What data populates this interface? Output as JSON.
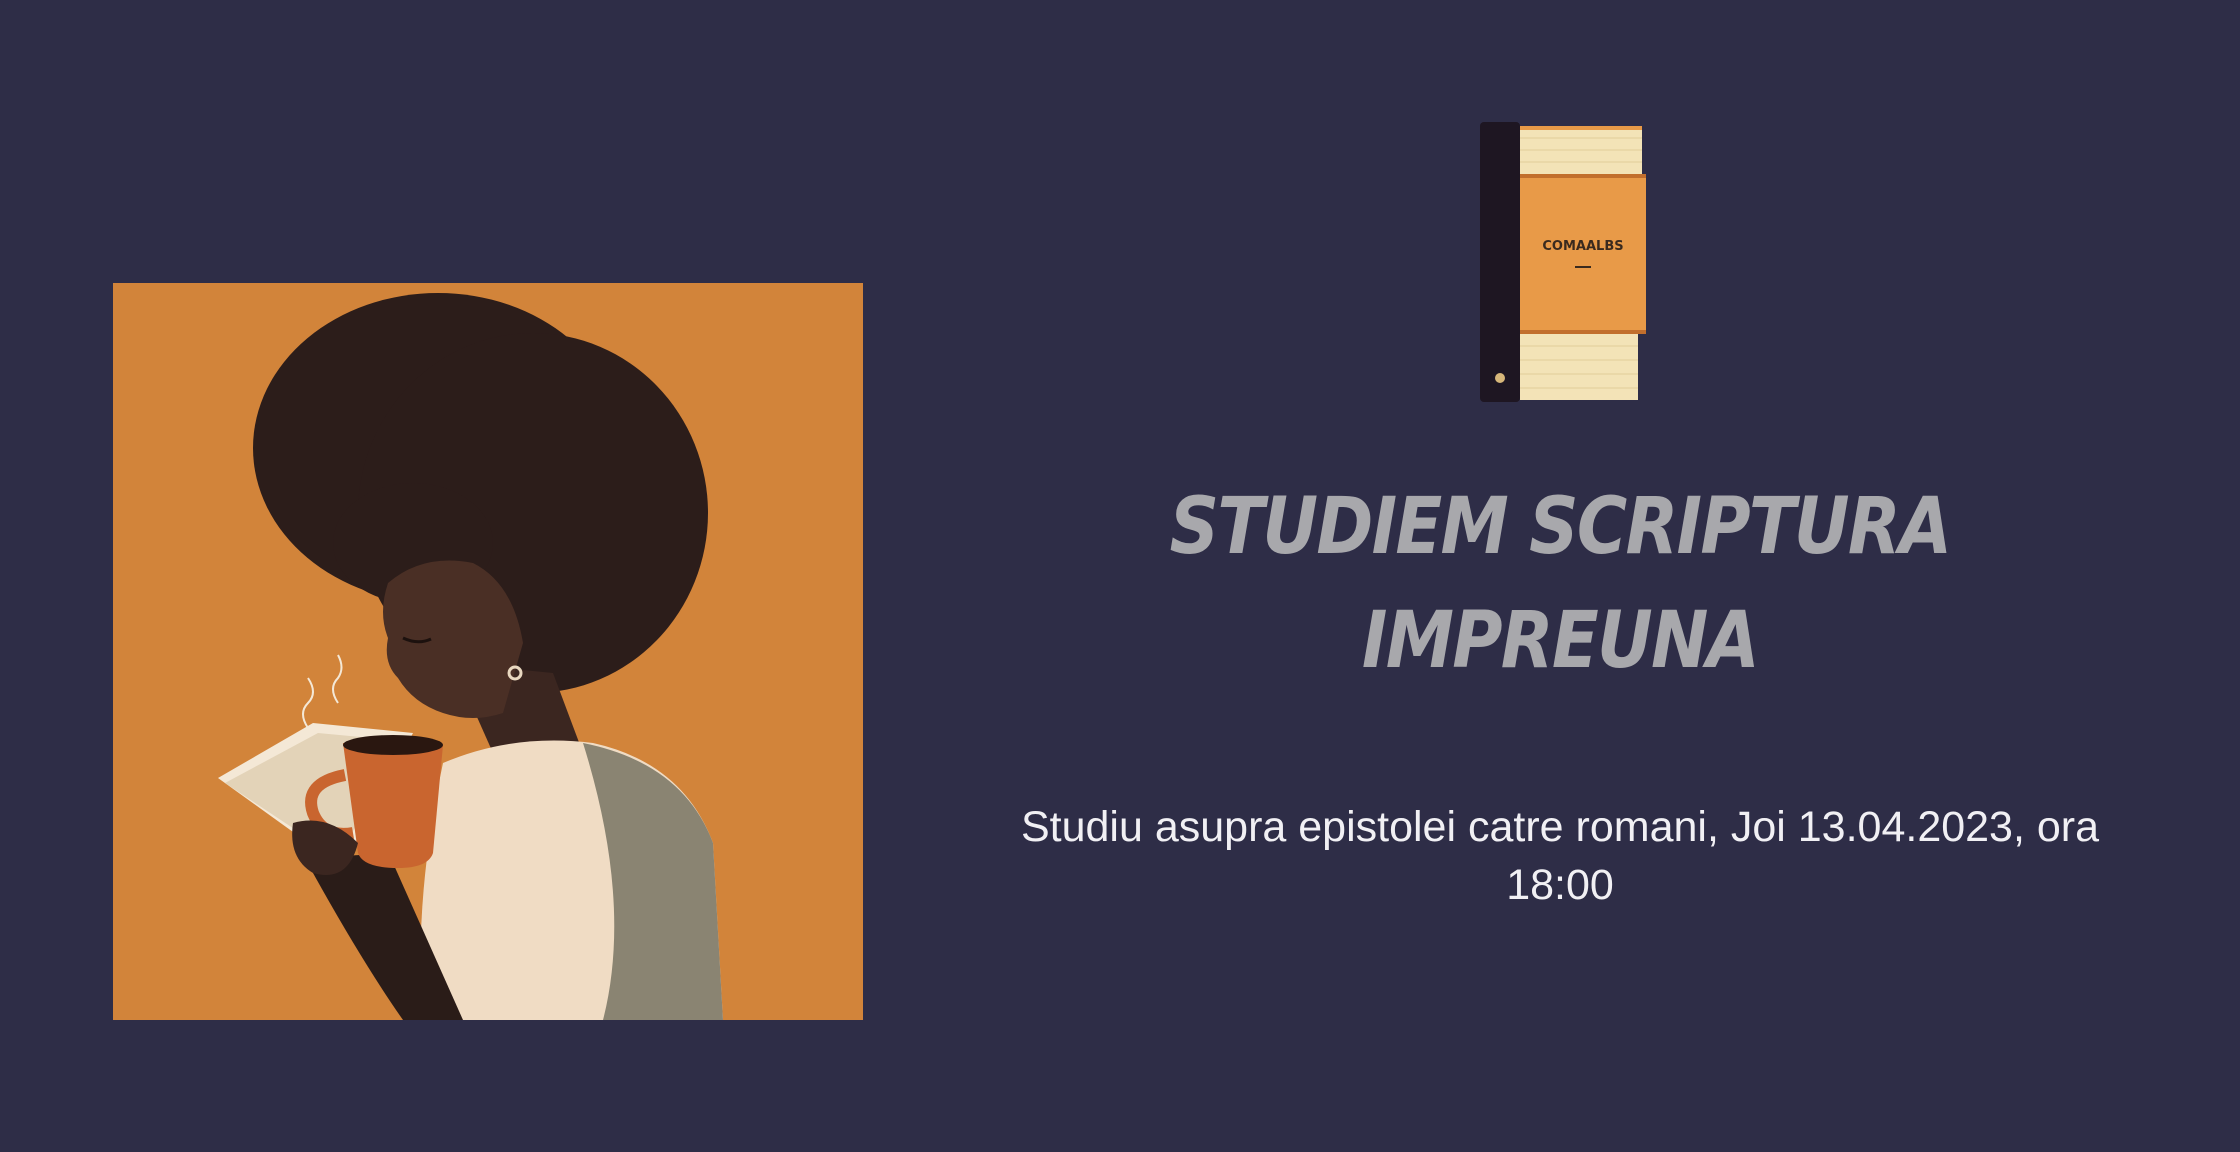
{
  "illustration": {
    "subject": "woman-reading-book-with-coffee",
    "background_color": "#d2843a"
  },
  "book_icon": {
    "spine_text": "COMAALBS",
    "cover_color": "#e89a48"
  },
  "title": {
    "line1": "STUDIEM SCRIPTURA",
    "line2": "IMPREUNA",
    "color": "#a8a8ac"
  },
  "subtitle": {
    "text": "Studiu asupra epistolei catre romani, Joi 13.04.2023, ora 18:00",
    "color": "#f1f0f4"
  },
  "page": {
    "background": "#2e2d47"
  }
}
